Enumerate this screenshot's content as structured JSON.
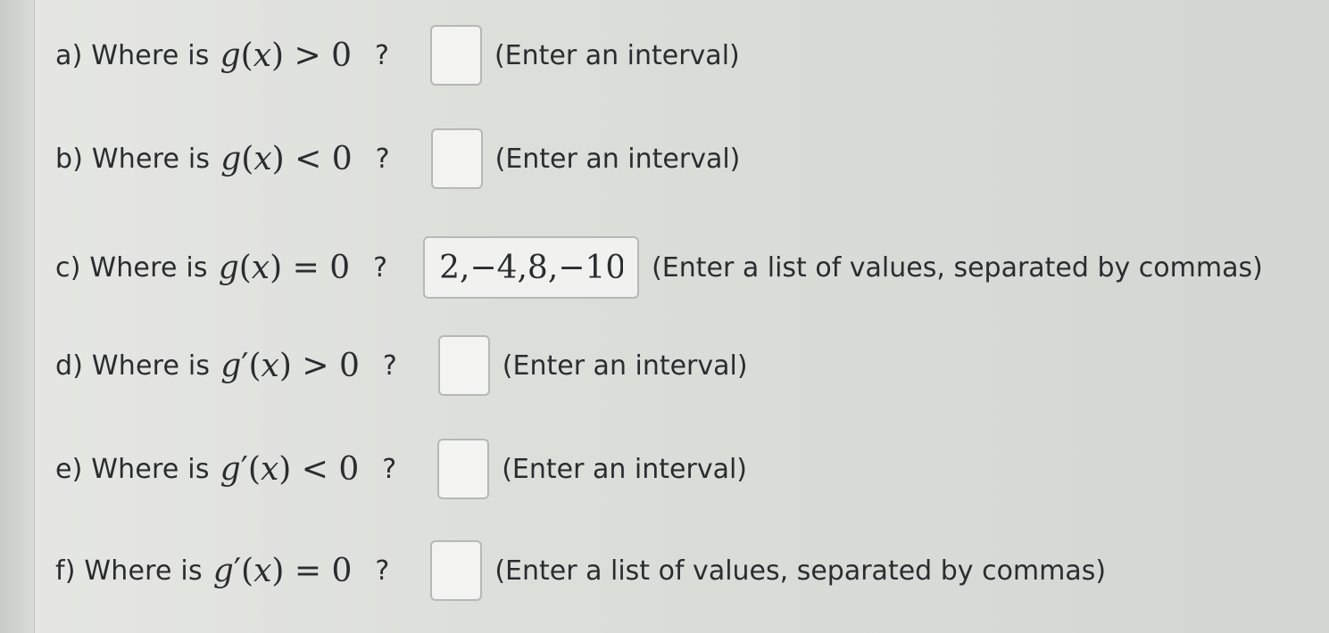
{
  "questions": [
    {
      "label": "a) Where is",
      "math": {
        "fn": "g",
        "prime": "",
        "open": "(",
        "var": "x",
        "close": ")",
        "rel": " > ",
        "rhs": "0"
      },
      "qmark": "?",
      "answer_value": "",
      "hint": "(Enter an interval)"
    },
    {
      "label": "b) Where is",
      "math": {
        "fn": "g",
        "prime": "",
        "open": "(",
        "var": "x",
        "close": ")",
        "rel": " < ",
        "rhs": "0"
      },
      "qmark": "?",
      "answer_value": "",
      "hint": "(Enter an interval)"
    },
    {
      "label": "c) Where is",
      "math": {
        "fn": "g",
        "prime": "",
        "open": "(",
        "var": "x",
        "close": ")",
        "rel": " = ",
        "rhs": "0"
      },
      "qmark": "?",
      "answer_value": "2,−4,8,−10",
      "hint": "(Enter a list of values, separated by commas)"
    },
    {
      "label": "d) Where is",
      "math": {
        "fn": "g",
        "prime": "′",
        "open": "(",
        "var": "x",
        "close": ")",
        "rel": " > ",
        "rhs": "0"
      },
      "qmark": "?",
      "answer_value": "",
      "hint": "(Enter an interval)"
    },
    {
      "label": "e) Where is",
      "math": {
        "fn": "g",
        "prime": "′",
        "open": "(",
        "var": "x",
        "close": ")",
        "rel": " < ",
        "rhs": "0"
      },
      "qmark": "?",
      "answer_value": "",
      "hint": "(Enter an interval)"
    },
    {
      "label": "f) Where is",
      "math": {
        "fn": "g",
        "prime": "′",
        "open": "(",
        "var": "x",
        "close": ")",
        "rel": " = ",
        "rhs": "0"
      },
      "qmark": "?",
      "answer_value": "",
      "hint": "(Enter a list of values, separated by commas)"
    }
  ]
}
